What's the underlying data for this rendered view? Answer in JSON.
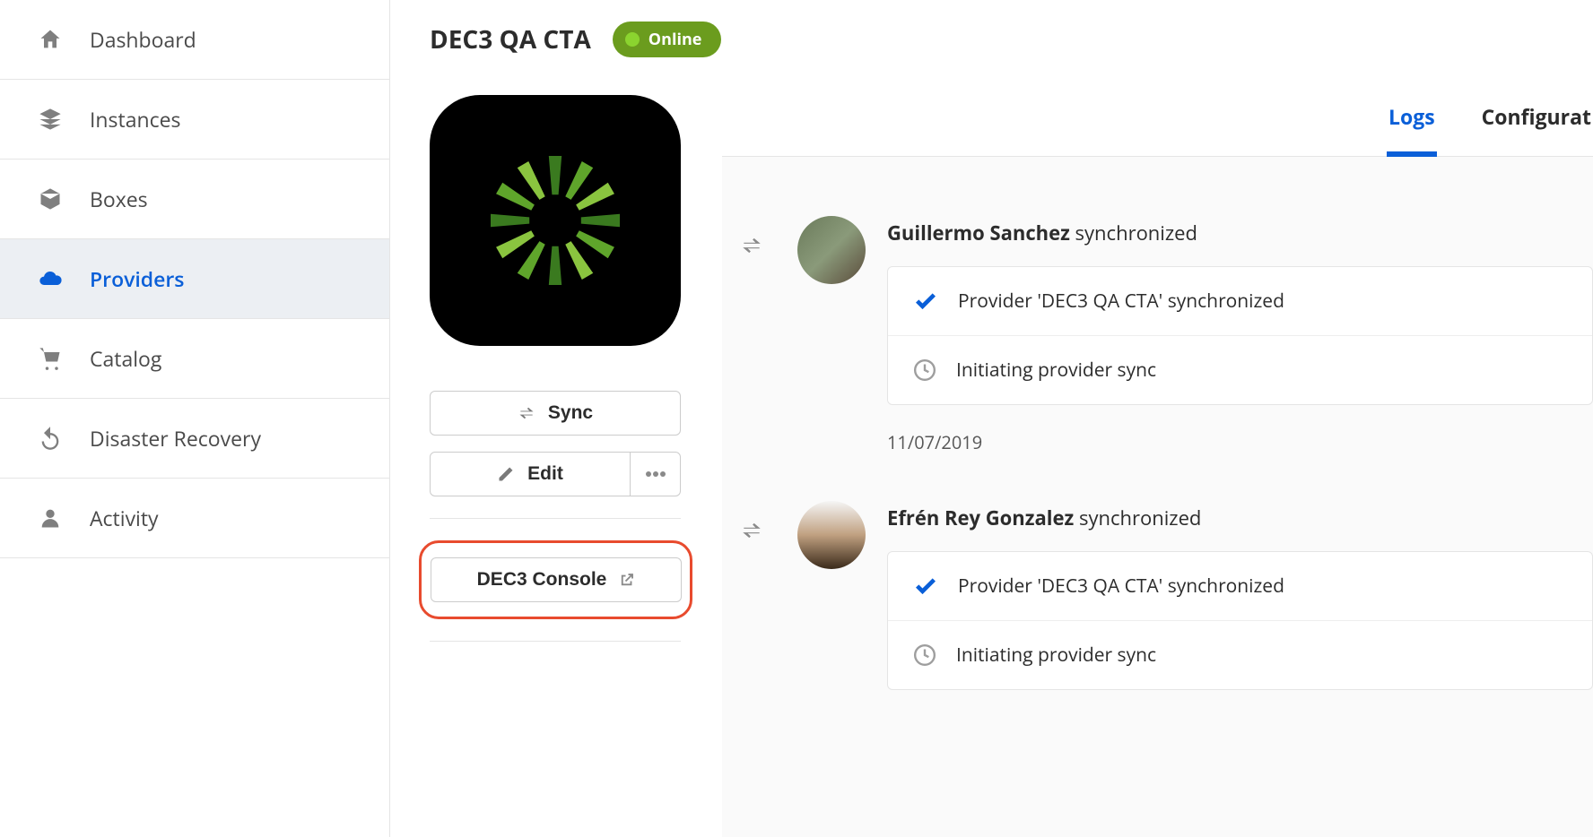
{
  "sidebar": {
    "items": [
      {
        "label": "Dashboard",
        "icon": "home"
      },
      {
        "label": "Instances",
        "icon": "layers"
      },
      {
        "label": "Boxes",
        "icon": "cube"
      },
      {
        "label": "Providers",
        "icon": "cloud"
      },
      {
        "label": "Catalog",
        "icon": "cart"
      },
      {
        "label": "Disaster Recovery",
        "icon": "undo"
      },
      {
        "label": "Activity",
        "icon": "user"
      }
    ]
  },
  "header": {
    "title": "DEC3 QA CTA",
    "status": "Online"
  },
  "actions": {
    "sync": "Sync",
    "edit": "Edit",
    "console": "DEC3 Console"
  },
  "tabs": {
    "logs": "Logs",
    "configuration": "Configurat"
  },
  "logs": [
    {
      "user": "Guillermo Sanchez",
      "verb": "synchronized",
      "rows": [
        {
          "type": "check",
          "text": "Provider 'DEC3 QA CTA' synchronized"
        },
        {
          "type": "clock",
          "text": "Initiating provider sync"
        }
      ],
      "date": "11/07/2019"
    },
    {
      "user": "Efrén Rey Gonzalez",
      "verb": "synchronized",
      "rows": [
        {
          "type": "check",
          "text": "Provider 'DEC3 QA CTA' synchronized"
        },
        {
          "type": "clock",
          "text": "Initiating provider sync"
        }
      ]
    }
  ]
}
